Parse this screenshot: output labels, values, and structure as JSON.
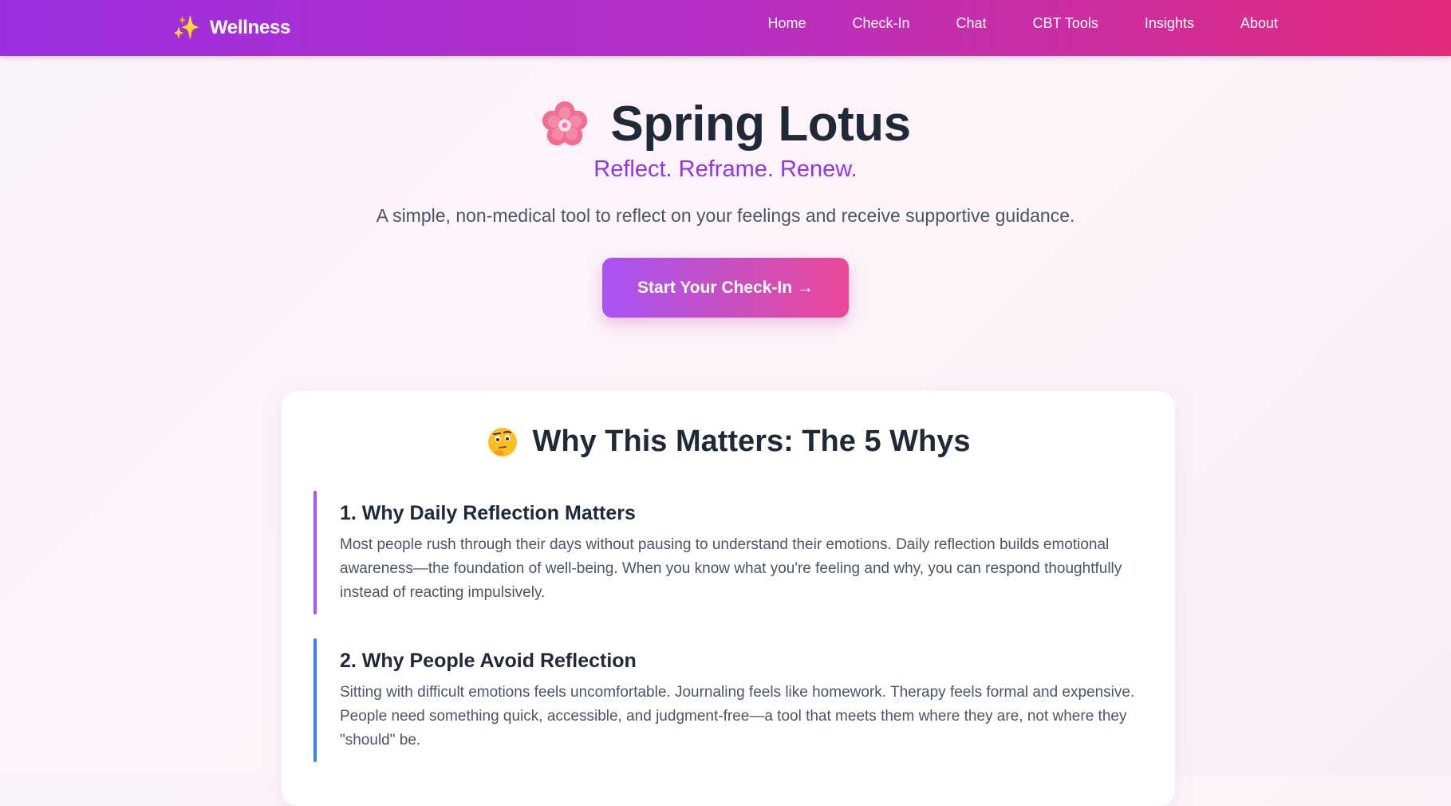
{
  "nav": {
    "brand_icon": "sparkles-icon",
    "brand": "Wellness",
    "links": [
      "Home",
      "Check-In",
      "Chat",
      "CBT Tools",
      "Insights",
      "About"
    ]
  },
  "hero": {
    "icon": "cherry-blossom-icon",
    "title": "Spring Lotus",
    "tagline": "Reflect. Reframe. Renew.",
    "description": "A simple, non-medical tool to reflect on your feelings and receive supportive guidance.",
    "cta_label": "Start Your Check-In →"
  },
  "why": {
    "icon": "thinking-face-icon",
    "title": "Why This Matters: The 5 Whys",
    "items": [
      {
        "heading": "1. Why Daily Reflection Matters",
        "body": "Most people rush through their days without pausing to understand their emotions. Daily reflection builds emotional awareness—the foundation of well-being. When you know what you're feeling and why, you can respond thoughtfully instead of reacting impulsively.",
        "accent": "#a855f7"
      },
      {
        "heading": "2. Why People Avoid Reflection",
        "body": "Sitting with difficult emotions feels uncomfortable. Journaling feels like homework. Therapy feels formal and expensive. People need something quick, accessible, and judgment-free—a tool that meets them where they are, not where they \"should\" be.",
        "accent": "#3b82f6"
      }
    ]
  },
  "colors": {
    "nav_start": "#9b2fe0",
    "nav_end": "#e22b7a",
    "accent_purple": "#9333ea",
    "cta_start": "#a855f7",
    "cta_end": "#ec4899"
  }
}
